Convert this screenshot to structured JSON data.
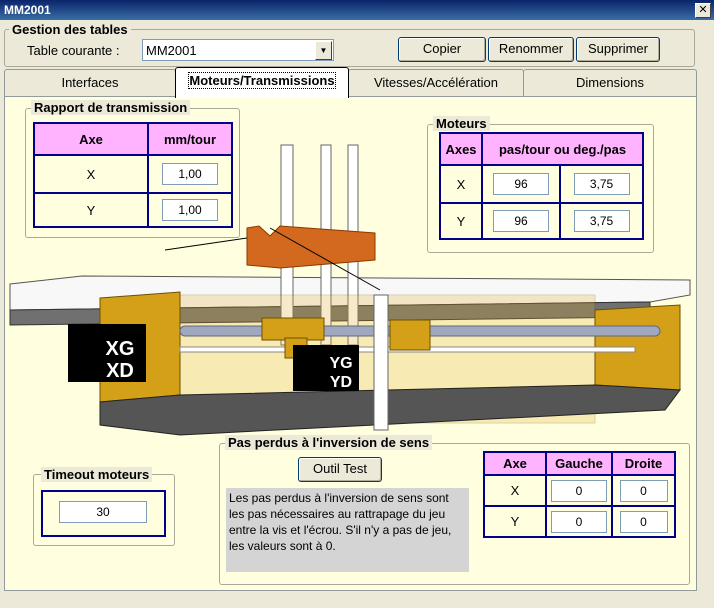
{
  "window": {
    "title": "MM2001",
    "close_icon": "close-icon"
  },
  "gestion": {
    "label": "Gestion des tables",
    "table_label": "Table courante :",
    "table_value": "MM2001",
    "buttons": {
      "copy": "Copier",
      "rename": "Renommer",
      "delete": "Supprimer"
    }
  },
  "tabs": [
    {
      "label": "Interfaces"
    },
    {
      "label": "Moteurs/Transmissions",
      "active": true
    },
    {
      "label": "Vitesses/Accélération"
    },
    {
      "label": "Dimensions"
    }
  ],
  "transmission": {
    "label": "Rapport de transmission",
    "headers": [
      "Axe",
      "mm/tour"
    ],
    "rows": [
      {
        "axe": "X",
        "value": "1,00"
      },
      {
        "axe": "Y",
        "value": "1,00"
      }
    ]
  },
  "moteurs": {
    "label": "Moteurs",
    "headers": [
      "Axes",
      "pas/tour ou deg./pas"
    ],
    "rows": [
      {
        "axe": "X",
        "pas": "96",
        "deg": "3,75"
      },
      {
        "axe": "Y",
        "pas": "96",
        "deg": "3,75"
      }
    ]
  },
  "diagram": {
    "label_xg": "XG",
    "label_xd": "XD",
    "label_yg": "YG",
    "label_yd": "YD"
  },
  "timeout": {
    "label": "Timeout moteurs",
    "value": "30"
  },
  "pas_perdus": {
    "label": "Pas perdus à l'inversion de sens",
    "test_button": "Outil Test",
    "note": "Les pas perdus à l'inversion de sens sont les pas nécessaires au rattrapage du jeu entre la vis et l'écrou. S'il n'y a pas de jeu, les valeurs sont à 0.",
    "headers": [
      "Axe",
      "Gauche",
      "Droite"
    ],
    "rows": [
      {
        "axe": "X",
        "gauche": "0",
        "droite": "0"
      },
      {
        "axe": "Y",
        "gauche": "0",
        "droite": "0"
      }
    ]
  }
}
